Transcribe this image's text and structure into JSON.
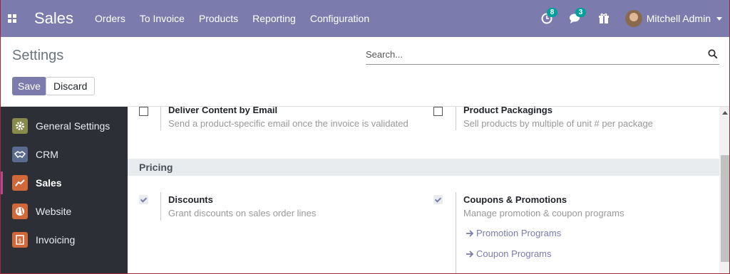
{
  "navbar": {
    "brand": "Sales",
    "menu": [
      "Orders",
      "To Invoice",
      "Products",
      "Reporting",
      "Configuration"
    ],
    "activity_count": "8",
    "messages_count": "3",
    "user_name": "Mitchell Admin"
  },
  "control_panel": {
    "title": "Settings",
    "search_placeholder": "Search...",
    "save_label": "Save",
    "discard_label": "Discard"
  },
  "sidebar": {
    "items": [
      {
        "label": "General Settings",
        "icon": "gear-icon",
        "color": "#8a8a4c"
      },
      {
        "label": "CRM",
        "icon": "handshake-icon",
        "color": "#5b6b8f"
      },
      {
        "label": "Sales",
        "icon": "chart-line-icon",
        "color": "#d1683a"
      },
      {
        "label": "Website",
        "icon": "globe-icon",
        "color": "#d1683a"
      },
      {
        "label": "Invoicing",
        "icon": "invoice-icon",
        "color": "#d1683a"
      }
    ]
  },
  "settings": {
    "deliver_title": "Deliver Content by Email",
    "deliver_desc": "Send a product-specific email once the invoice is validated",
    "packagings_title": "Product Packagings",
    "packagings_desc": "Sell products by multiple of unit # per package",
    "pricing_header": "Pricing",
    "discounts_title": "Discounts",
    "discounts_desc": "Grant discounts on sales order lines",
    "coupons_title": "Coupons & Promotions",
    "coupons_desc": "Manage promotion & coupon programs",
    "promotion_link": "Promotion Programs",
    "coupon_link": "Coupon Programs"
  },
  "colors": {
    "navbar": "#7c7bad",
    "sidebar": "#2c2f36",
    "link": "#7c7bad"
  }
}
